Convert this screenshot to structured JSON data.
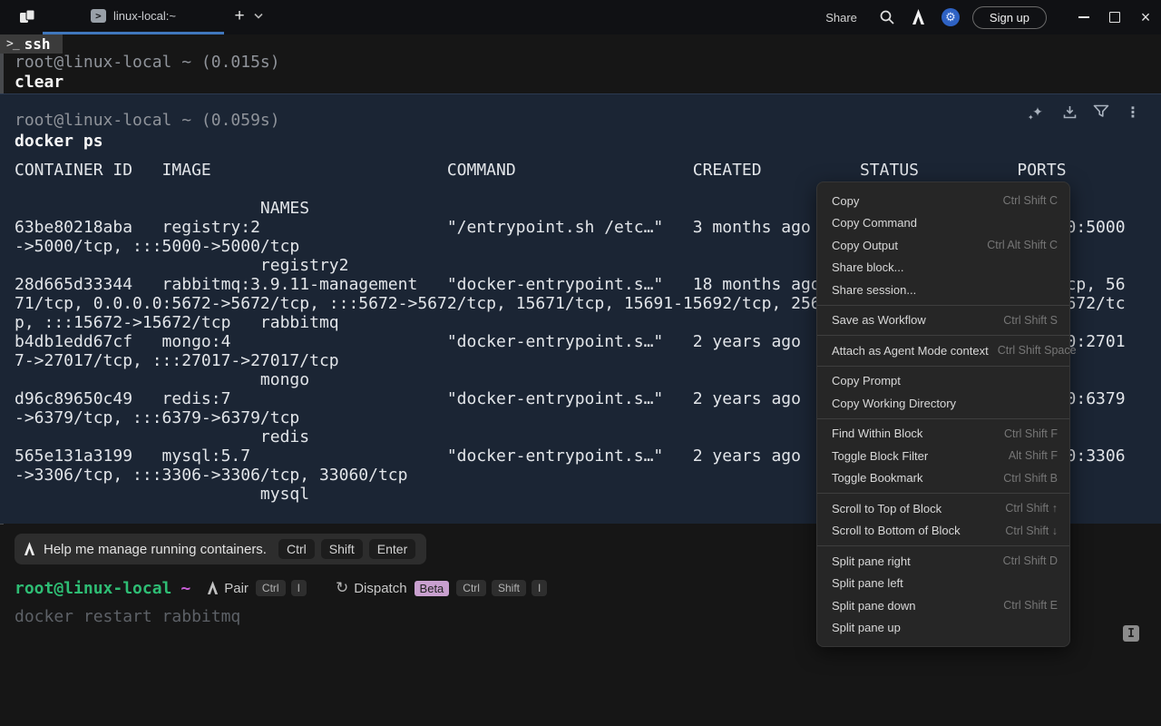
{
  "titlebar": {
    "tab_label": "linux-local:~",
    "tab_icon_glyph": ">",
    "new_tab_glyph": "+",
    "share_label": "Share",
    "signup_label": "Sign up"
  },
  "session": {
    "badge_glyph": ">_",
    "badge_label": "ssh",
    "block1": {
      "prompt": "root@linux-local ~ (0.015s)",
      "command": "clear"
    },
    "block2": {
      "prompt": "root@linux-local ~ (0.059s)",
      "command": "docker ps"
    }
  },
  "docker_output": {
    "lines": [
      "CONTAINER ID   IMAGE                        COMMAND                  CREATED          STATUS          PORTS",
      "",
      "                         NAMES",
      "63be80218aba   registry:2                   \"/entrypoint.sh /etc…\"   3 months ago    Up 3 months     0.0.0.0:5000",
      "->5000/tcp, :::5000->5000/tcp",
      "                         registry2",
      "28d665d33344   rabbitmq:3.9.11-management   \"docker-entrypoint.s…\"   18 months ago   Up 18 months    4369/tcp, 56",
      "71/tcp, 0.0.0.0:5672->5672/tcp, :::5672->5672/tcp, 15671/tcp, 15691-15692/tcp, 25672/tcp, 0.0.0.0:15672->15672/tc",
      "p, :::15672->15672/tcp   rabbitmq",
      "b4db1edd67cf   mongo:4                      \"docker-entrypoint.s…\"   2 years ago     Up 2 years      0.0.0.0:2701",
      "7->27017/tcp, :::27017->27017/tcp",
      "                         mongo",
      "d96c89650c49   redis:7                      \"docker-entrypoint.s…\"   2 years ago     Up 2 years      0.0.0.0:6379",
      "->6379/tcp, :::6379->6379/tcp",
      "                         redis",
      "565e131a3199   mysql:5.7                    \"docker-entrypoint.s…\"   2 years ago     Up 2 years      0.0.0.0:3306",
      "->3306/tcp, :::3306->3306/tcp, 33060/tcp",
      "                         mysql"
    ]
  },
  "context_menu": {
    "groups": [
      [
        {
          "label": "Copy",
          "shortcut": "Ctrl Shift C"
        },
        {
          "label": "Copy Command",
          "shortcut": ""
        },
        {
          "label": "Copy Output",
          "shortcut": "Ctrl Alt Shift C"
        },
        {
          "label": "Share block...",
          "shortcut": ""
        },
        {
          "label": "Share session...",
          "shortcut": ""
        }
      ],
      [
        {
          "label": "Save as Workflow",
          "shortcut": "Ctrl Shift S"
        }
      ],
      [
        {
          "label": "Attach as Agent Mode context",
          "shortcut": "Ctrl Shift Space"
        }
      ],
      [
        {
          "label": "Copy Prompt",
          "shortcut": ""
        },
        {
          "label": "Copy Working Directory",
          "shortcut": ""
        }
      ],
      [
        {
          "label": "Find Within Block",
          "shortcut": "Ctrl Shift F"
        },
        {
          "label": "Toggle Block Filter",
          "shortcut": "Alt Shift F"
        },
        {
          "label": "Toggle Bookmark",
          "shortcut": "Ctrl Shift B"
        }
      ],
      [
        {
          "label": "Scroll to Top of Block",
          "shortcut": "Ctrl Shift ↑"
        },
        {
          "label": "Scroll to Bottom of Block",
          "shortcut": "Ctrl Shift ↓"
        }
      ],
      [
        {
          "label": "Split pane right",
          "shortcut": "Ctrl Shift D"
        },
        {
          "label": "Split pane left",
          "shortcut": ""
        },
        {
          "label": "Split pane down",
          "shortcut": "Ctrl Shift E"
        },
        {
          "label": "Split pane up",
          "shortcut": ""
        }
      ]
    ]
  },
  "suggestion": {
    "text": "Help me manage running containers.",
    "keys": [
      "Ctrl",
      "Shift",
      "Enter"
    ]
  },
  "prompt": {
    "user": "root@linux-local",
    "symbol": "~",
    "pair_label": "Pair",
    "pair_keys": [
      "Ctrl",
      "I"
    ],
    "dispatch_label": "Dispatch",
    "beta_label": "Beta",
    "dispatch_keys": [
      "Ctrl",
      "Shift",
      "I"
    ],
    "ghost_command": "docker restart rabbitmq"
  },
  "indicator_badge": "I",
  "colors": {
    "block_bg": "#1b2534",
    "accent_blue": "#4077bd",
    "gear_blue": "#2e62c4",
    "prompt_green": "#2ebd74",
    "prompt_magenta": "#c95fd8",
    "beta_pink": "#c9a0cf"
  }
}
